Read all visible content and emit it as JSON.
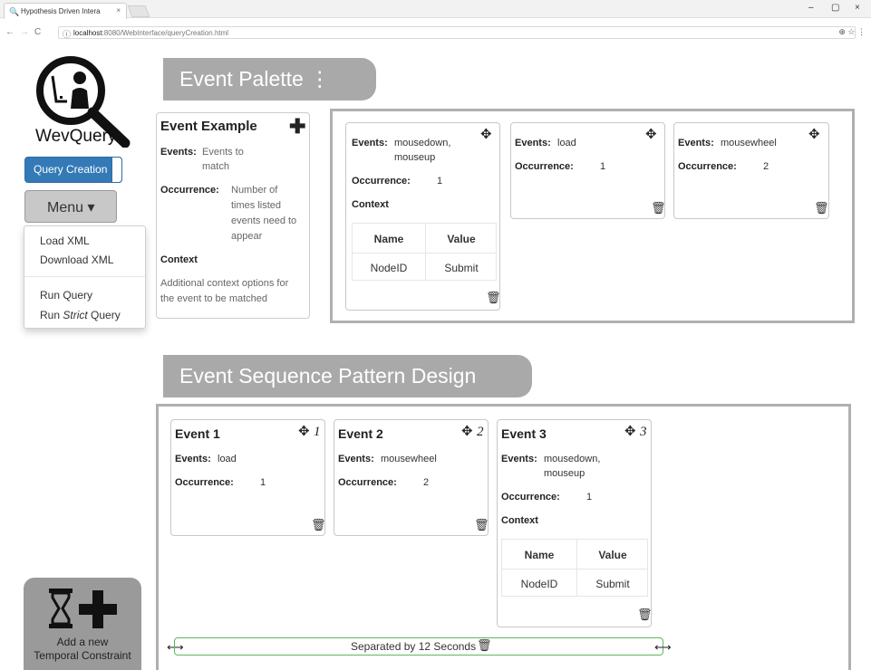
{
  "browser": {
    "tab_title": "Hypothesis Driven Intera",
    "tab_close": "×",
    "url_host": "localhost",
    "url_path": ":8080/WebInterface/queryCreation.html",
    "win_min": "–",
    "win_max": "▢",
    "win_close": "×",
    "nav_back": "←",
    "nav_fwd": "→",
    "nav_reload": "C",
    "url_icons": "⊕ ☆ ⋮"
  },
  "sidebar": {
    "logo_text": "WevQuery",
    "query_creation_label": "Query Creation",
    "menu_label": "Menu ▾",
    "menu_items": [
      "Load XML",
      "Download XML",
      "Run Query"
    ],
    "run_strict_prefix": "Run ",
    "run_strict_em": "Strict",
    "run_strict_suffix": " Query",
    "temporal_constraint_line1": "Add a new",
    "temporal_constraint_line2": "Temporal Constraint"
  },
  "palette": {
    "header": "Event Palette ⋮",
    "example": {
      "title": "Event Example",
      "events_label": "Events:",
      "events_line1": "Events to",
      "events_line2": "match",
      "occurrence_label": "Occurrence:",
      "occurrence_lines": [
        "Number of",
        "times listed",
        "events need to",
        "appear"
      ],
      "context_label": "Context",
      "context_line1": "Additional context options for",
      "context_line2": "the event to be matched"
    },
    "cards": [
      {
        "events_label": "Events:",
        "events_line1": "mousedown,",
        "events_line2": "mouseup",
        "occurrence_label": "Occurrence:",
        "occurrence": "1",
        "context_label": "Context",
        "table_header": [
          "Name",
          "Value"
        ],
        "table_row": [
          "NodeID",
          "Submit"
        ]
      },
      {
        "events_label": "Events:",
        "events": "load",
        "occurrence_label": "Occurrence:",
        "occurrence": "1"
      },
      {
        "events_label": "Events:",
        "events": "mousewheel",
        "occurrence_label": "Occurrence:",
        "occurrence": "2"
      }
    ]
  },
  "sequence": {
    "header": "Event Sequence Pattern Design",
    "events": [
      {
        "title": "Event 1",
        "num": "1",
        "events_label": "Events:",
        "events": "load",
        "occurrence_label": "Occurrence:",
        "occurrence": "1"
      },
      {
        "title": "Event 2",
        "num": "2",
        "events_label": "Events:",
        "events": "mousewheel",
        "occurrence_label": "Occurrence:",
        "occurrence": "2"
      },
      {
        "title": "Event 3",
        "num": "3",
        "events_label": "Events:",
        "events_line1": "mousedown,",
        "events_line2": "mouseup",
        "occurrence_label": "Occurrence:",
        "occurrence": "1",
        "context_label": "Context",
        "table_header": [
          "Name",
          "Value"
        ],
        "table_row": [
          "NodeID",
          "Submit"
        ]
      }
    ],
    "separator_text": "Separated by 12 Seconds"
  },
  "icons": {
    "move": "✥",
    "trash": "🗑",
    "plus": "✚",
    "resize": "⟷"
  }
}
